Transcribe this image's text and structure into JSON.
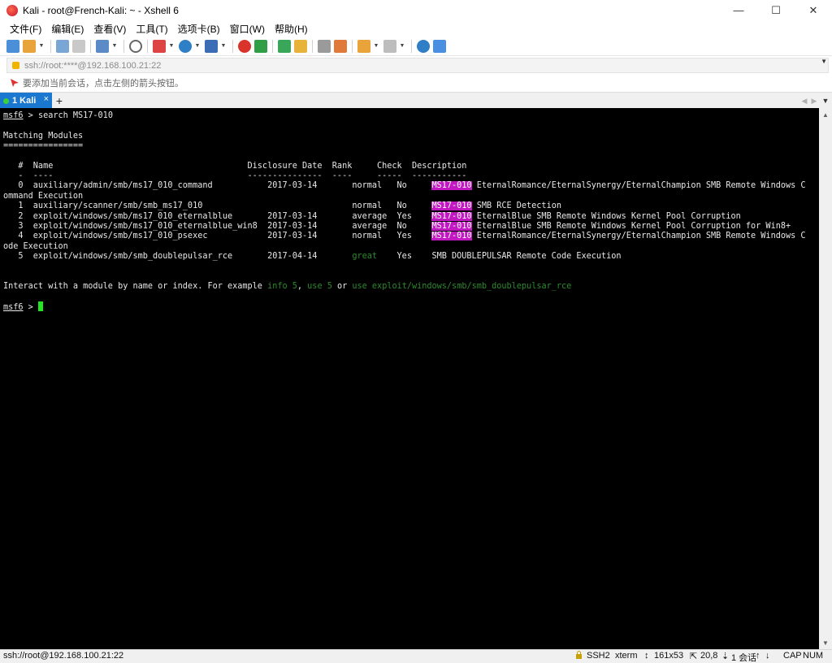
{
  "window": {
    "title": "Kali - root@French-Kali: ~ - Xshell 6",
    "minimize_glyph": "—",
    "maximize_glyph": "☐",
    "close_glyph": "✕"
  },
  "menu": [
    "文件(F)",
    "编辑(E)",
    "查看(V)",
    "工具(T)",
    "选项卡(B)",
    "窗口(W)",
    "帮助(H)"
  ],
  "toolbar": {
    "icons": [
      "new-session-icon",
      "open-folder-icon",
      "connect-icon",
      "disconnect-icon",
      "transfer-icon",
      "find-icon",
      "properties-icon",
      "globe-icon",
      "font-icon",
      "xftp-icon",
      "xmanager-icon",
      "fullscreen-icon",
      "lock-icon",
      "keyboard-icon",
      "highlight-icon",
      "script-icon",
      "layout-icon",
      "help-icon",
      "chat-icon"
    ],
    "colors": {
      "accent_blue": "#1b78d0",
      "orange": "#e8a33b",
      "green": "#2f9e44",
      "red": "#d9342b"
    }
  },
  "address": {
    "value": "ssh://root:****@192.168.100.21:22"
  },
  "hint": {
    "text": "要添加当前会话，点击左侧的箭头按钮。"
  },
  "tabs": [
    {
      "label": "1 Kali",
      "close": "×"
    }
  ],
  "tab_add": "+",
  "tab_nav": {
    "prev": "◀",
    "next": "▶",
    "menu": "▼"
  },
  "terminal": {
    "prompt": "msf6",
    "command": " > search MS17-010",
    "heading": "Matching Modules",
    "heading_rule": "================",
    "header_row": "   #  Name                                       Disclosure Date  Rank     Check  Description",
    "header_rule": "   -  ----                                       ---------------  ----     -----  -----------",
    "rows": [
      {
        "pre": "   0  auxiliary/admin/smb/ms17_010_command           2017-03-14       normal   No     ",
        "hl": "MS17-010",
        "post": " EternalRomance/EternalSynergy/EternalChampion SMB Remote Windows C"
      },
      {
        "wrap": "ommand Execution"
      },
      {
        "pre": "   1  auxiliary/scanner/smb/smb_ms17_010                              normal   No     ",
        "hl": "MS17-010",
        "post": " SMB RCE Detection"
      },
      {
        "pre": "   2  exploit/windows/smb/ms17_010_eternalblue       2017-03-14       average  Yes    ",
        "hl": "MS17-010",
        "post": " EternalBlue SMB Remote Windows Kernel Pool Corruption"
      },
      {
        "pre": "   3  exploit/windows/smb/ms17_010_eternalblue_win8  2017-03-14       average  No     ",
        "hl": "MS17-010",
        "post": " EternalBlue SMB Remote Windows Kernel Pool Corruption for Win8+"
      },
      {
        "pre": "   4  exploit/windows/smb/ms17_010_psexec            2017-03-14       normal   Yes    ",
        "hl": "MS17-010",
        "post": " EternalRomance/EternalSynergy/EternalChampion SMB Remote Windows C"
      },
      {
        "wrap": "ode Execution"
      },
      {
        "pre": "   5  exploit/windows/smb/smb_doublepulsar_rce       2017-04-14       ",
        "green": "great",
        "post": "    Yes    SMB DOUBLEPULSAR Remote Code Execution"
      }
    ],
    "interact": {
      "t1": "Interact with a module by name or index. For example ",
      "g1": "info 5",
      "t2": ", ",
      "g2": "use 5",
      "t3": " or ",
      "g3": "use exploit/windows/smb/smb_doublepulsar_rce"
    },
    "prompt2": "msf6",
    "prompt2_rest": " > ",
    "colors": {
      "background": "#000000",
      "text": "#e8e8e8",
      "highlight": "#c218c2",
      "green": "#2d8a2d",
      "cursor": "#21e621"
    }
  },
  "status": {
    "connection": "ssh://root@192.168.100.21:22",
    "protocol": "SSH2",
    "terminal_type": "xterm",
    "size": "161x53",
    "cursor_pos": "20,8",
    "sessions": "1 会话",
    "caps": "CAP",
    "num": "NUM"
  }
}
